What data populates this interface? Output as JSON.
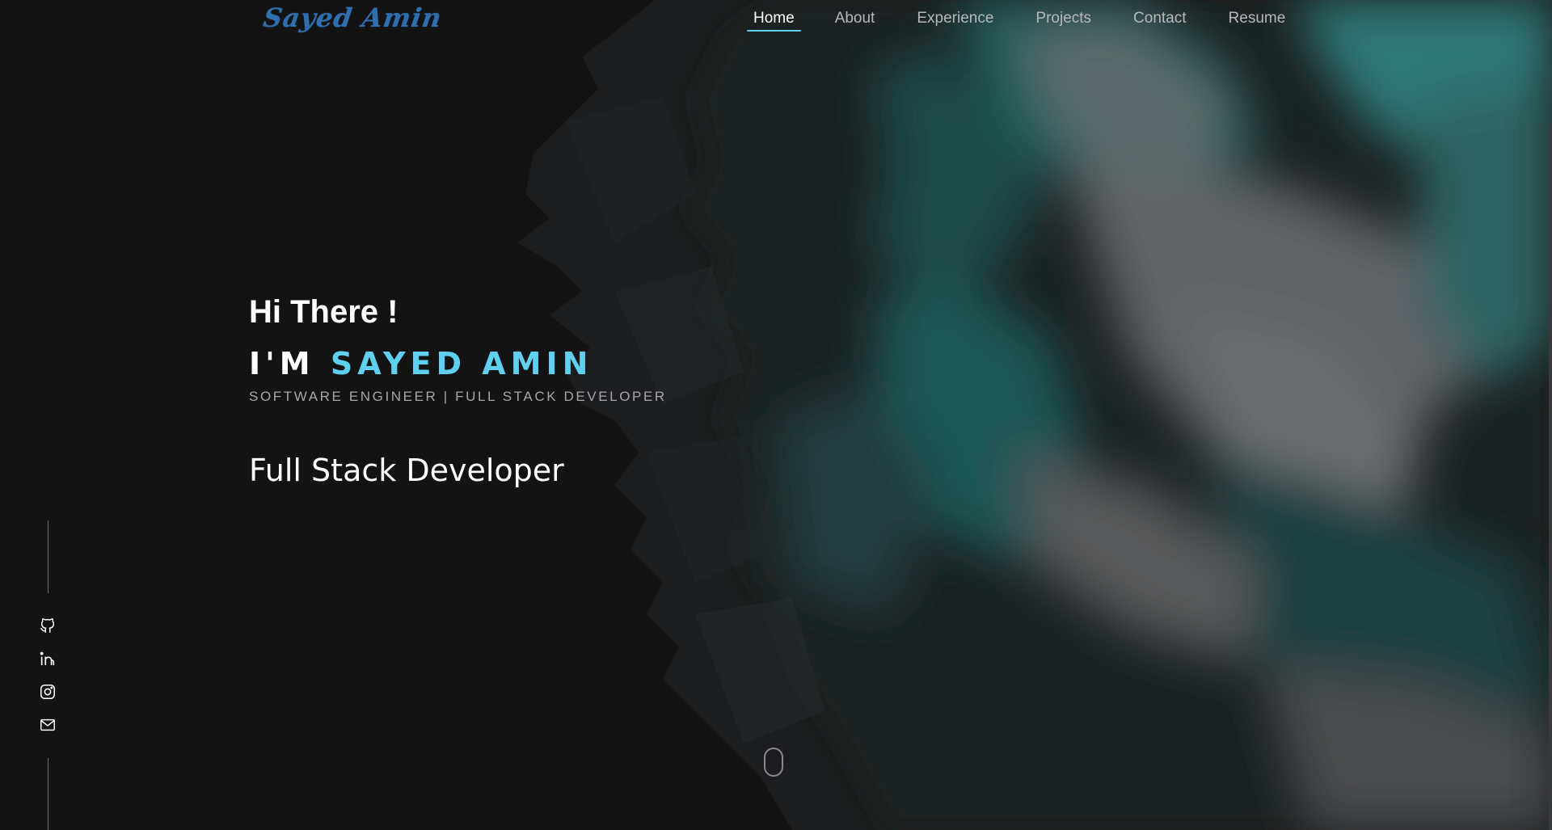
{
  "logo": {
    "text": "Sayed Amin"
  },
  "nav": {
    "items": [
      {
        "label": "Home",
        "active": true
      },
      {
        "label": "About",
        "active": false
      },
      {
        "label": "Experience",
        "active": false
      },
      {
        "label": "Projects",
        "active": false
      },
      {
        "label": "Contact",
        "active": false
      },
      {
        "label": "Resume",
        "active": false
      }
    ]
  },
  "hero": {
    "greeting": "Hi There !",
    "name_prefix": "I'M ",
    "name_highlight": "SAYED AMIN",
    "subtitle": "SOFTWARE ENGINEER | FULL STACK DEVELOPER",
    "typed_text": "Full Stack Developer"
  },
  "social": {
    "icons": [
      "github-icon",
      "linkedin-icon",
      "instagram-icon",
      "mail-icon"
    ]
  },
  "colors": {
    "background": "#131314",
    "accent": "#5fd0f0",
    "logo": "#2e6fb0",
    "teal": "#2a6a6a"
  }
}
